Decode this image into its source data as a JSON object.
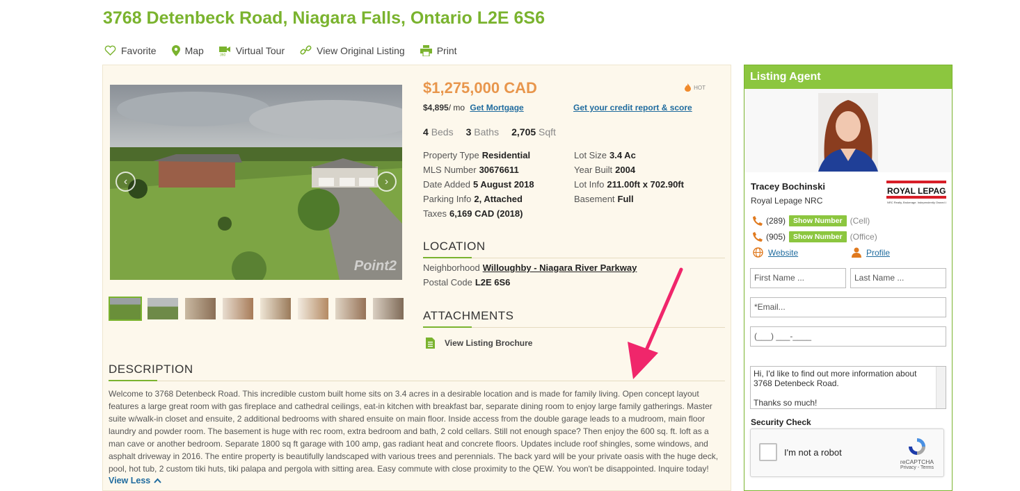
{
  "title": "3768 Detenbeck Road, Niagara Falls, Ontario L2E 6S6",
  "actions": [
    {
      "label": "Favorite",
      "icon": "heart-icon"
    },
    {
      "label": "Map",
      "icon": "map-pin-icon"
    },
    {
      "label": "Virtual Tour",
      "icon": "video-360-icon"
    },
    {
      "label": "View Original Listing",
      "icon": "link-icon"
    },
    {
      "label": "Print",
      "icon": "printer-icon"
    }
  ],
  "photo": {
    "watermark": "Point2"
  },
  "listing": {
    "price": "$1,275,000 CAD",
    "hot_label": "HOT",
    "monthly": "$4,895",
    "monthly_unit": "/ mo",
    "mortgage_link": "Get Mortgage",
    "credit_link": "Get your credit report & score",
    "beds": "4",
    "beds_label": "Beds",
    "baths": "3",
    "baths_label": "Baths",
    "sqft": "2,705",
    "sqft_label": "Sqft",
    "facts_left": [
      {
        "k": "Property Type",
        "v": "Residential"
      },
      {
        "k": "MLS Number",
        "v": "30676611"
      },
      {
        "k": "Date Added",
        "v": "5 August 2018"
      },
      {
        "k": "Parking Info",
        "v": "2, Attached"
      },
      {
        "k": "Taxes",
        "v": "6,169 CAD (2018)"
      }
    ],
    "facts_right": [
      {
        "k": "Lot Size",
        "v": "3.4 Ac"
      },
      {
        "k": "Year Built",
        "v": "2004"
      },
      {
        "k": "Lot Info",
        "v": "211.00ft x 702.90ft"
      },
      {
        "k": "Basement",
        "v": "Full"
      }
    ]
  },
  "location": {
    "heading": "LOCATION",
    "neighborhood_label": "Neighborhood",
    "neighborhood": "Willoughby - Niagara River Parkway",
    "postal_label": "Postal Code",
    "postal": "L2E 6S6"
  },
  "attachments": {
    "heading": "ATTACHMENTS",
    "brochure": "View Listing Brochure"
  },
  "description": {
    "heading": "DESCRIPTION",
    "text": "Welcome to 3768 Detenbeck Road. This incredible custom built home sits on 3.4 acres in a desirable location and is made for family living. Open concept layout features a large great room with gas fireplace and cathedral ceilings, eat-in kitchen with breakfast bar, separate dining room to enjoy large family gatherings. Master suite w/walk-in closet and ensuite, 2 additional bedrooms with shared ensuite on main floor. Inside access from the double garage leads to a mudroom, main floor laundry and powder room. The basement is huge with rec room, extra bedroom and bath, 2 cold cellars. Still not enough space? Then enjoy the 600 sq. ft. loft as a man cave or another bedroom. Separate 1800 sq ft garage with 100 amp, gas radiant heat and concrete floors. Updates include roof shingles, some windows, and asphalt driveway in 2016. The entire property is beautifully landscaped with various trees and perennials. The back yard will be your private oasis with the huge deck, pool, hot tub, 2 custom tiki huts, tiki palapa and pergola with sitting area. Easy commute with close proximity to the QEW. You won't be disappointed. Inquire today!",
    "toggle": "View Less"
  },
  "agent": {
    "heading": "Listing Agent",
    "name": "Tracey Bochinski",
    "company": "Royal Lepage NRC",
    "brand_logo_text": "ROYAL LEPAGE",
    "brand_logo_sub": "NRC Realty, Brokerage. Independently Owned & Operated",
    "phones": [
      {
        "prefix": "(289)",
        "button": "Show Number",
        "type": "(Cell)"
      },
      {
        "prefix": "(905)",
        "button": "Show Number",
        "type": "(Office)"
      }
    ],
    "website": "Website",
    "profile": "Profile"
  },
  "form": {
    "first_name": "First Name ...",
    "last_name": "Last Name ...",
    "email": "*Email...",
    "phone": "(___) ___-____",
    "message": "Hi, I'd like to find out more information about 3768 Detenbeck Road.\n\nThanks so much!",
    "security_label": "Security Check",
    "captcha_label": "I'm not a robot",
    "captcha_brand": "reCAPTCHA",
    "captcha_links": "Privacy - Terms"
  },
  "colors": {
    "brand_green": "#7ab32e",
    "price_orange": "#e8964c",
    "link_blue": "#1f6b9e",
    "arrow_pink": "#f0266b"
  }
}
